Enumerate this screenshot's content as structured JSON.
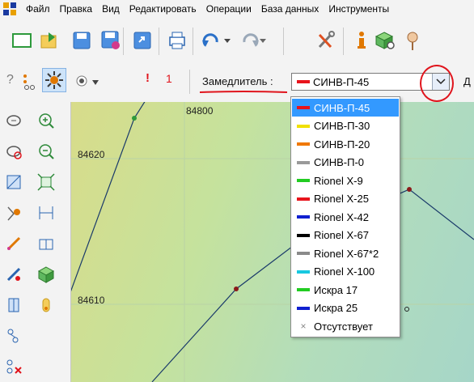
{
  "menu": {
    "items": [
      "Файл",
      "Правка",
      "Вид",
      "Редактировать",
      "Операции",
      "База данных",
      "Инструменты"
    ]
  },
  "toolbar2": {
    "help_symbol": "?",
    "one_label": "1",
    "retarder_label": "Замедлитель :",
    "combo_value": "СИНВ-П-45",
    "combo_color": "#e8141c",
    "next_letter": "Д"
  },
  "map": {
    "labels": [
      "84800",
      "84620",
      "84610"
    ]
  },
  "dropdown": {
    "items": [
      {
        "label": "СИНВ-П-45",
        "color": "#e8141c",
        "selected": true
      },
      {
        "label": "СИНВ-П-30",
        "color": "#f0e000"
      },
      {
        "label": "СИНВ-П-20",
        "color": "#f07800"
      },
      {
        "label": "СИНВ-П-0",
        "color": "#9a9a9a"
      },
      {
        "label": "Rionel X-9",
        "color": "#22cc22"
      },
      {
        "label": "Rionel X-25",
        "color": "#e8141c"
      },
      {
        "label": "Rionel X-42",
        "color": "#1020d0"
      },
      {
        "label": "Rionel X-67",
        "color": "#000000"
      },
      {
        "label": "Rionel X-67*2",
        "color": "#8a8a8a"
      },
      {
        "label": "Rionel X-100",
        "color": "#18c8e0"
      },
      {
        "label": "Искра 17",
        "color": "#22cc22"
      },
      {
        "label": "Искра 25",
        "color": "#1020d0"
      },
      {
        "label": "Отсутствует",
        "color": null
      }
    ]
  },
  "annotations": {
    "highlight_color": "#e0141c"
  }
}
